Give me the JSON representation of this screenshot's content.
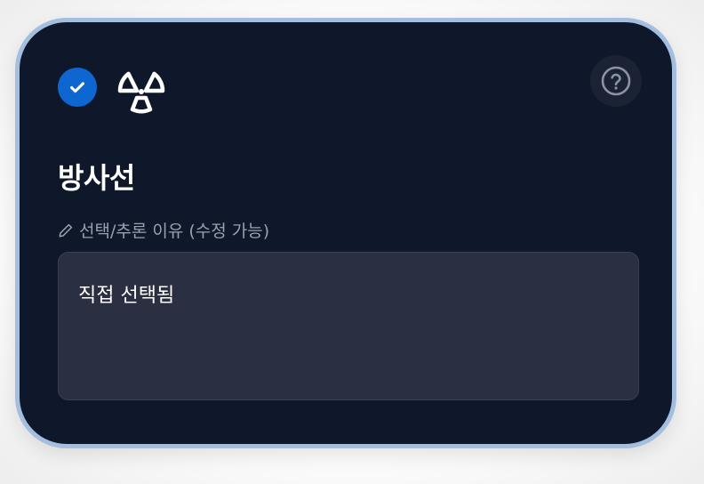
{
  "card": {
    "title": "방사선",
    "selected": true,
    "icons": {
      "selected_indicator": "check-circle-icon",
      "category": "radiation-icon",
      "help": "question-circle-icon",
      "edit": "pencil-icon"
    },
    "reason": {
      "label": "선택/추론 이유 (수정 가능)",
      "value": "직접 선택됨"
    }
  },
  "colors": {
    "card_background": "#0f172a",
    "card_border": "#a4bedf",
    "accent": "#0e67d0",
    "input_background": "#2a2f42"
  }
}
